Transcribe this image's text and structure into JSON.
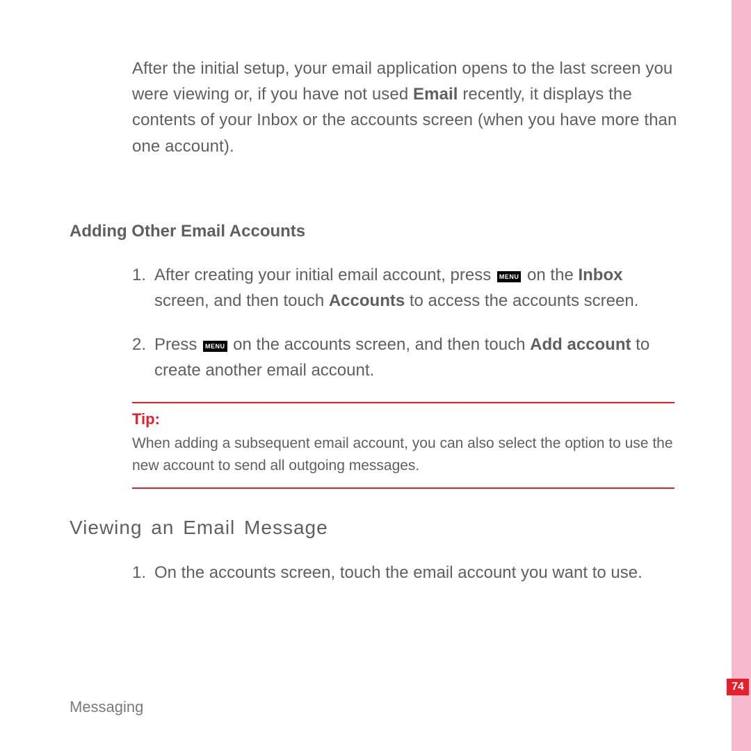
{
  "intro": {
    "pre": "After the initial setup, your email application opens to the last screen you were viewing or, if you have not used ",
    "bold": "Email",
    "post": " recently, it displays the contents of your Inbox or the accounts screen (when you have more than one account)."
  },
  "section_adding": {
    "heading": "Adding Other Email Accounts",
    "steps": [
      {
        "num": "1.",
        "pre": "After creating your initial email account, press ",
        "icon": "MENU",
        "mid1": " on the ",
        "bold1": "Inbox",
        "mid2": " screen, and then touch ",
        "bold2": "Accounts",
        "post": " to access the accounts screen."
      },
      {
        "num": "2.",
        "pre": "Press ",
        "icon": "MENU",
        "mid1": " on the accounts screen, and then touch ",
        "bold1": "Add account",
        "post": " to create another email account."
      }
    ]
  },
  "tip": {
    "label": "Tip:",
    "text": "When adding a subsequent email account, you can also select the option to use the new account to send all outgoing messages."
  },
  "section_viewing": {
    "heading": "Viewing an Email Message",
    "steps": [
      {
        "num": "1.",
        "text": "On the accounts screen, touch the email account you want to use."
      }
    ]
  },
  "footer": "Messaging",
  "page_number": "74"
}
